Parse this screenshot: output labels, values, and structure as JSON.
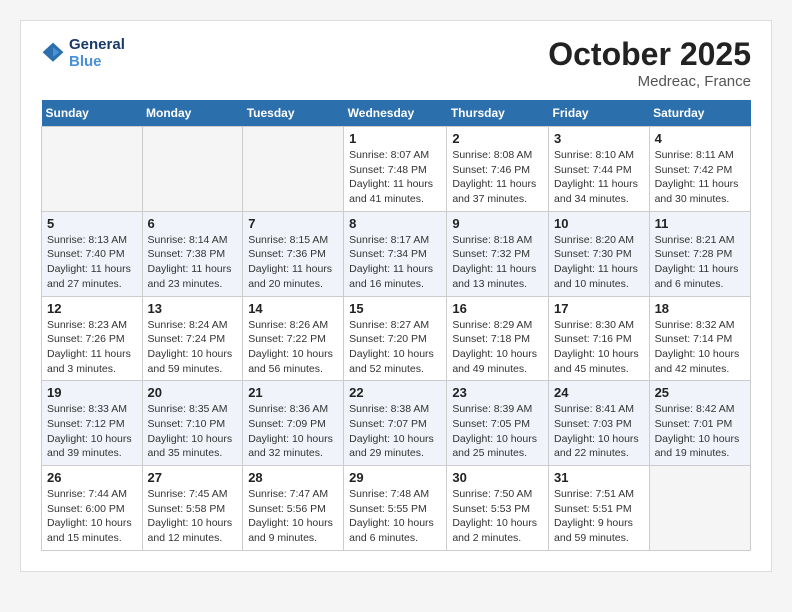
{
  "header": {
    "logo_line1": "General",
    "logo_line2": "Blue",
    "month": "October 2025",
    "location": "Medreac, France"
  },
  "weekdays": [
    "Sunday",
    "Monday",
    "Tuesday",
    "Wednesday",
    "Thursday",
    "Friday",
    "Saturday"
  ],
  "weeks": [
    [
      {
        "day": "",
        "info": ""
      },
      {
        "day": "",
        "info": ""
      },
      {
        "day": "",
        "info": ""
      },
      {
        "day": "1",
        "info": "Sunrise: 8:07 AM\nSunset: 7:48 PM\nDaylight: 11 hours\nand 41 minutes."
      },
      {
        "day": "2",
        "info": "Sunrise: 8:08 AM\nSunset: 7:46 PM\nDaylight: 11 hours\nand 37 minutes."
      },
      {
        "day": "3",
        "info": "Sunrise: 8:10 AM\nSunset: 7:44 PM\nDaylight: 11 hours\nand 34 minutes."
      },
      {
        "day": "4",
        "info": "Sunrise: 8:11 AM\nSunset: 7:42 PM\nDaylight: 11 hours\nand 30 minutes."
      }
    ],
    [
      {
        "day": "5",
        "info": "Sunrise: 8:13 AM\nSunset: 7:40 PM\nDaylight: 11 hours\nand 27 minutes."
      },
      {
        "day": "6",
        "info": "Sunrise: 8:14 AM\nSunset: 7:38 PM\nDaylight: 11 hours\nand 23 minutes."
      },
      {
        "day": "7",
        "info": "Sunrise: 8:15 AM\nSunset: 7:36 PM\nDaylight: 11 hours\nand 20 minutes."
      },
      {
        "day": "8",
        "info": "Sunrise: 8:17 AM\nSunset: 7:34 PM\nDaylight: 11 hours\nand 16 minutes."
      },
      {
        "day": "9",
        "info": "Sunrise: 8:18 AM\nSunset: 7:32 PM\nDaylight: 11 hours\nand 13 minutes."
      },
      {
        "day": "10",
        "info": "Sunrise: 8:20 AM\nSunset: 7:30 PM\nDaylight: 11 hours\nand 10 minutes."
      },
      {
        "day": "11",
        "info": "Sunrise: 8:21 AM\nSunset: 7:28 PM\nDaylight: 11 hours\nand 6 minutes."
      }
    ],
    [
      {
        "day": "12",
        "info": "Sunrise: 8:23 AM\nSunset: 7:26 PM\nDaylight: 11 hours\nand 3 minutes."
      },
      {
        "day": "13",
        "info": "Sunrise: 8:24 AM\nSunset: 7:24 PM\nDaylight: 10 hours\nand 59 minutes."
      },
      {
        "day": "14",
        "info": "Sunrise: 8:26 AM\nSunset: 7:22 PM\nDaylight: 10 hours\nand 56 minutes."
      },
      {
        "day": "15",
        "info": "Sunrise: 8:27 AM\nSunset: 7:20 PM\nDaylight: 10 hours\nand 52 minutes."
      },
      {
        "day": "16",
        "info": "Sunrise: 8:29 AM\nSunset: 7:18 PM\nDaylight: 10 hours\nand 49 minutes."
      },
      {
        "day": "17",
        "info": "Sunrise: 8:30 AM\nSunset: 7:16 PM\nDaylight: 10 hours\nand 45 minutes."
      },
      {
        "day": "18",
        "info": "Sunrise: 8:32 AM\nSunset: 7:14 PM\nDaylight: 10 hours\nand 42 minutes."
      }
    ],
    [
      {
        "day": "19",
        "info": "Sunrise: 8:33 AM\nSunset: 7:12 PM\nDaylight: 10 hours\nand 39 minutes."
      },
      {
        "day": "20",
        "info": "Sunrise: 8:35 AM\nSunset: 7:10 PM\nDaylight: 10 hours\nand 35 minutes."
      },
      {
        "day": "21",
        "info": "Sunrise: 8:36 AM\nSunset: 7:09 PM\nDaylight: 10 hours\nand 32 minutes."
      },
      {
        "day": "22",
        "info": "Sunrise: 8:38 AM\nSunset: 7:07 PM\nDaylight: 10 hours\nand 29 minutes."
      },
      {
        "day": "23",
        "info": "Sunrise: 8:39 AM\nSunset: 7:05 PM\nDaylight: 10 hours\nand 25 minutes."
      },
      {
        "day": "24",
        "info": "Sunrise: 8:41 AM\nSunset: 7:03 PM\nDaylight: 10 hours\nand 22 minutes."
      },
      {
        "day": "25",
        "info": "Sunrise: 8:42 AM\nSunset: 7:01 PM\nDaylight: 10 hours\nand 19 minutes."
      }
    ],
    [
      {
        "day": "26",
        "info": "Sunrise: 7:44 AM\nSunset: 6:00 PM\nDaylight: 10 hours\nand 15 minutes."
      },
      {
        "day": "27",
        "info": "Sunrise: 7:45 AM\nSunset: 5:58 PM\nDaylight: 10 hours\nand 12 minutes."
      },
      {
        "day": "28",
        "info": "Sunrise: 7:47 AM\nSunset: 5:56 PM\nDaylight: 10 hours\nand 9 minutes."
      },
      {
        "day": "29",
        "info": "Sunrise: 7:48 AM\nSunset: 5:55 PM\nDaylight: 10 hours\nand 6 minutes."
      },
      {
        "day": "30",
        "info": "Sunrise: 7:50 AM\nSunset: 5:53 PM\nDaylight: 10 hours\nand 2 minutes."
      },
      {
        "day": "31",
        "info": "Sunrise: 7:51 AM\nSunset: 5:51 PM\nDaylight: 9 hours\nand 59 minutes."
      },
      {
        "day": "",
        "info": ""
      }
    ]
  ]
}
